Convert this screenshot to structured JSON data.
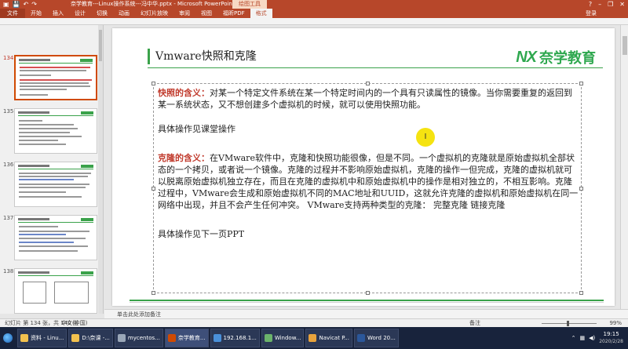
{
  "window": {
    "title": "奈学教育---Linux操作系统---冯中华.pptx - Microsoft PowerPoint",
    "contextual_tools": "绘图工具",
    "login": "登录"
  },
  "ribbon": {
    "tabs": [
      "文件",
      "开始",
      "插入",
      "设计",
      "切换",
      "动画",
      "幻灯片放映",
      "审阅",
      "视图",
      "福昕PDF",
      "格式"
    ]
  },
  "thumbnails": [
    {
      "num": "134",
      "active": true
    },
    {
      "num": "135",
      "active": false
    },
    {
      "num": "136",
      "active": false
    },
    {
      "num": "137",
      "active": false
    },
    {
      "num": "138",
      "active": false
    }
  ],
  "slide": {
    "title": "Vmware快照和克隆",
    "logo_mark": "NX",
    "logo_text": "奈学教育",
    "snapshot_label": "快照的含义：",
    "snapshot_text": "对某一个特定文件系统在某一个特定时间内的一个具有只读属性的镜像。当你需要重复的返回到某一系统状态，又不想创建多个虚拟机的时候，就可以使用快照功能。",
    "snapshot_ops": "具体操作见课堂操作",
    "clone_label": "克隆的含义：",
    "clone_text": "在VMware软件中，克隆和快照功能很像，但是不同。一个虚拟机的克隆就是原始虚拟机全部状态的一个拷贝，或者说一个镜像。克隆的过程并不影响原始虚拟机，克隆的操作一但完成，克隆的虚拟机就可以脱离原始虚拟机独立存在，而且在克隆的虚拟机中和原始虚拟机中的操作是相对独立的，不相互影响。克隆过程中，VMware会生成和原始虚拟机不同的MAC地址和UUID，这就允许克隆的虚拟机和原始虚拟机在同一网络中出现，并且不会产生任何冲突。 VMware支持两种类型的克隆： 完整克隆 链接克隆",
    "clone_ops": "具体操作见下一页PPT",
    "cursor_glyph": "I"
  },
  "notes_placeholder": "单击此处添加备注",
  "status": {
    "slide_info": "幻灯片 第 134 张，共 140 张",
    "language": "中文(中国)",
    "notes": "备注",
    "zoom": "99%"
  },
  "taskbar": {
    "items": [
      {
        "label": "资料 - Linu...",
        "color": "#f2c14e"
      },
      {
        "label": "D:\\奈课 -...",
        "color": "#f2c14e"
      },
      {
        "label": "mycentos...",
        "color": "#9aa7b8"
      },
      {
        "label": "奈学教育...",
        "color": "#d04a02"
      },
      {
        "label": "192.168.1...",
        "color": "#4a90d9"
      },
      {
        "label": "Window...",
        "color": "#6bb36b"
      },
      {
        "label": "Navicat P...",
        "color": "#e8a33c"
      },
      {
        "label": "Word 20...",
        "color": "#2b579a"
      }
    ],
    "time": "19:15",
    "date": "2020/2/28"
  }
}
